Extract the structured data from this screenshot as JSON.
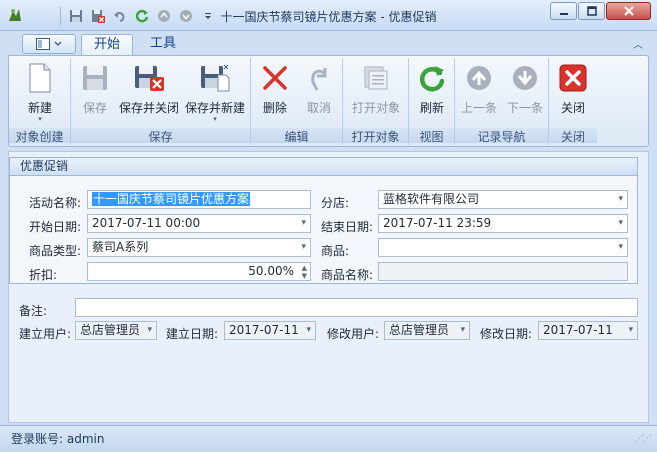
{
  "window": {
    "title": "十一国庆节蔡司镜片优惠方案 - 优惠促销"
  },
  "tabs": [
    {
      "label": "开始"
    },
    {
      "label": "工具"
    }
  ],
  "ribbon": {
    "new_label": "新建",
    "save_label": "保存",
    "save_close_label": "保存并关闭",
    "save_new_label": "保存并新建",
    "delete_label": "删除",
    "cancel_label": "取消",
    "open_label": "打开对象",
    "refresh_label": "刷新",
    "prev_label": "上一条",
    "next_label": "下一条",
    "close_label": "关闭",
    "groups": {
      "create": "对象创建",
      "save": "保存",
      "edit": "编辑",
      "open": "打开对象",
      "view": "视图",
      "nav": "记录导航",
      "close": "关闭"
    }
  },
  "form": {
    "groupbox_title": "优惠促销",
    "activity_name_label": "活动名称:",
    "activity_name_value": "十一国庆节蔡司镜片优惠方案",
    "branch_label": "分店:",
    "branch_value": "蓝格软件有限公司",
    "start_date_label": "开始日期:",
    "start_date_value": "2017-07-11 00:00",
    "end_date_label": "结束日期:",
    "end_date_value": "2017-07-11 23:59",
    "product_type_label": "商品类型:",
    "product_type_value": "蔡司A系列",
    "product_label": "商品:",
    "product_value": "",
    "discount_label": "折扣:",
    "discount_value": "50.00%",
    "product_name_label": "商品名称:",
    "product_name_value": "",
    "remark_label": "备注:",
    "remark_value": "",
    "created_by_label": "建立用户:",
    "created_by_value": "总店管理员",
    "created_date_label": "建立日期:",
    "created_date_value": "2017-07-11",
    "modified_by_label": "修改用户:",
    "modified_by_value": "总店管理员",
    "modified_date_label": "修改日期:",
    "modified_date_value": "2017-07-11"
  },
  "status": {
    "login_text": "登录账号: admin"
  },
  "colors": {
    "accent": "#15428b",
    "selection": "#3399ff",
    "close_red": "#d9342b",
    "refresh_green": "#3aa33a"
  }
}
